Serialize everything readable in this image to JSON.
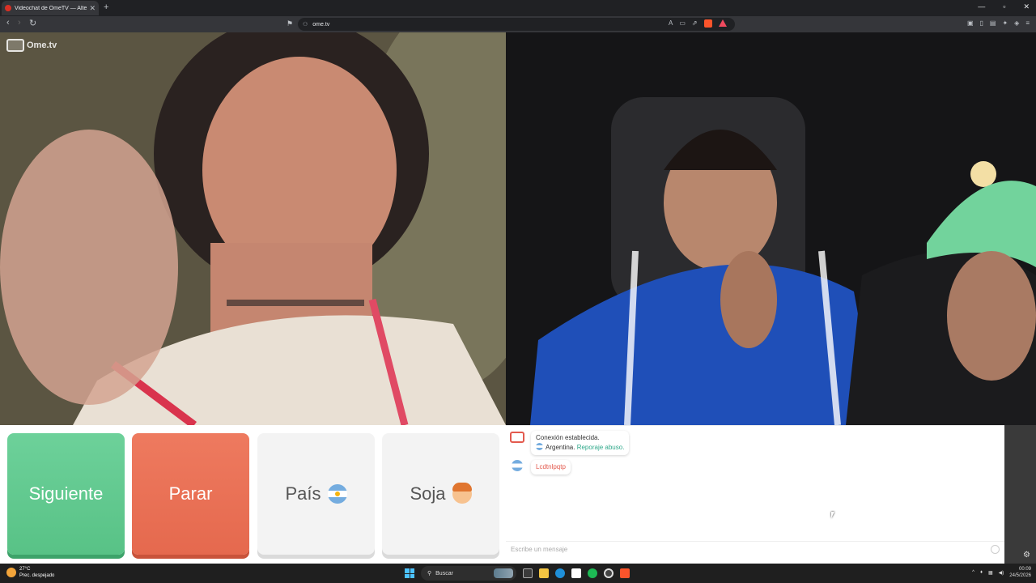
{
  "browser": {
    "tab_title": "Videochat de OmeTV — Alte",
    "url": "ome.tv"
  },
  "site": {
    "logo_text": "Ome.tv"
  },
  "controls": {
    "next_label": "Siguiente",
    "stop_label": "Parar",
    "country_label": "País",
    "gender_label": "Soja"
  },
  "chat": {
    "messages": [
      {
        "line1": "Conexión establecida.",
        "country": "Argentina.",
        "report": "Reporaje abuso."
      },
      {
        "text": "Lcdtnlpqtp"
      }
    ],
    "input_placeholder": "Escribe un mensaje"
  },
  "taskbar": {
    "temperature": "27°C",
    "weather": "Prec. despejado",
    "search_label": "Buscar",
    "time": "00:09",
    "date": "24/5/2026"
  },
  "colors": {
    "next": "#5fc88e",
    "stop": "#e96f54",
    "link": "#2fa88a"
  }
}
